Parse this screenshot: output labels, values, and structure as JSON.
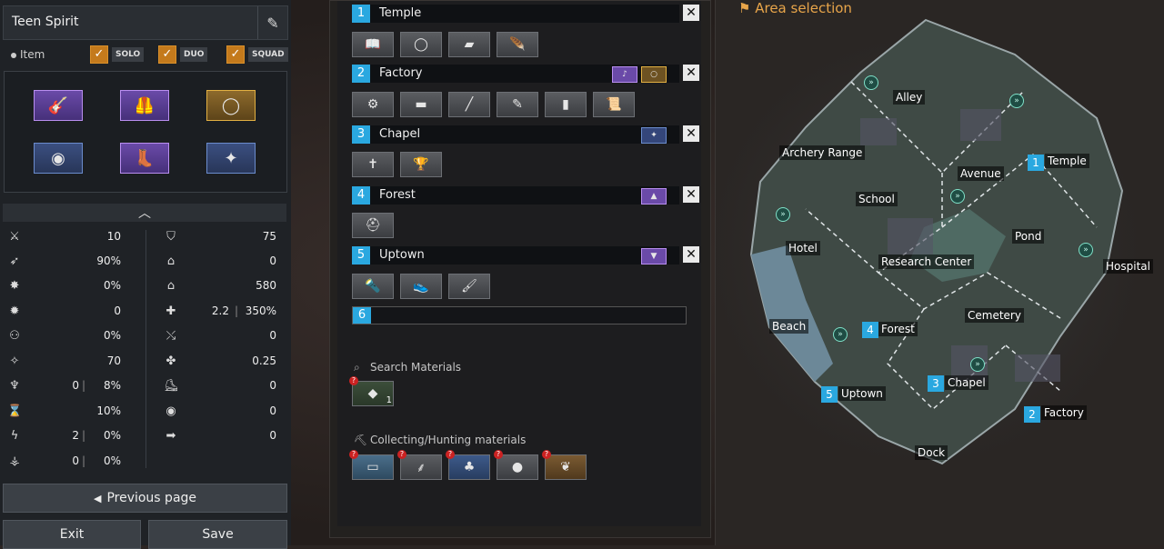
{
  "left": {
    "build_name": "Teen Spirit",
    "item_label": "Item",
    "modes": [
      "SOLO",
      "DUO",
      "SQUAD"
    ],
    "equipment": [
      {
        "icon": "guitar-icon",
        "rarity": "epic"
      },
      {
        "icon": "chest-armor-icon",
        "rarity": "epic"
      },
      {
        "icon": "wreath-icon",
        "rarity": "legendary"
      },
      {
        "icon": "ring-icon",
        "rarity": "rare"
      },
      {
        "icon": "boots-icon",
        "rarity": "epic"
      },
      {
        "icon": "bracelet-icon",
        "rarity": "rare"
      }
    ],
    "stats_left": [
      {
        "icon": "attack-power-icon",
        "value": "10"
      },
      {
        "icon": "attack-speed-icon",
        "value": "90%"
      },
      {
        "icon": "critical-chance-icon",
        "value": "0%"
      },
      {
        "icon": "critical-damage-icon",
        "value": "0"
      },
      {
        "icon": "life-steal-icon",
        "value": "0%"
      },
      {
        "icon": "skill-amp-icon",
        "value": "70"
      },
      {
        "icon": "cooldown-icon",
        "pre": "0",
        "value": "8%"
      },
      {
        "icon": "hourglass-icon",
        "value": "10%"
      },
      {
        "icon": "penetration-icon",
        "pre": "2",
        "value": "0%"
      },
      {
        "icon": "omnisyphon-icon",
        "pre": "0",
        "value": "0%"
      }
    ],
    "stats_right": [
      {
        "icon": "defense-icon",
        "value": "75"
      },
      {
        "icon": "hp-regen-icon",
        "value": "0"
      },
      {
        "icon": "max-hp-icon",
        "value": "580"
      },
      {
        "icon": "heal-icon",
        "pre": "2.2",
        "value": "350%"
      },
      {
        "icon": "tenacity-icon",
        "value": "0"
      },
      {
        "icon": "sp-regen-icon",
        "value": "0.25"
      },
      {
        "icon": "movement-icon",
        "value": "0"
      },
      {
        "icon": "vision-icon",
        "value": "0"
      },
      {
        "icon": "move-speed-icon",
        "value": "0"
      }
    ],
    "prev_page": "Previous page",
    "exit": "Exit",
    "save": "Save"
  },
  "routes": [
    {
      "num": "1",
      "name": "Temple",
      "tags": [],
      "materials": [
        "book-icon",
        "wire-icon",
        "leather-icon",
        "feather-icon"
      ]
    },
    {
      "num": "2",
      "name": "Factory",
      "tags": [
        "guitar-icon",
        "wreath-icon"
      ],
      "materials": [
        "gun-part-icon",
        "tube-icon",
        "rod-icon",
        "syringe-icon",
        "battery-icon",
        "scroll-icon"
      ]
    },
    {
      "num": "3",
      "name": "Chapel",
      "tags": [
        "bracelet-icon"
      ],
      "materials": [
        "cross-icon",
        "chalice-icon"
      ]
    },
    {
      "num": "4",
      "name": "Forest",
      "tags": [
        "chest-armor-icon"
      ],
      "materials": [
        "helmet-icon"
      ]
    },
    {
      "num": "5",
      "name": "Uptown",
      "tags": [
        "boots-icon"
      ],
      "materials": [
        "torch-icon",
        "sneakers-icon",
        "brush-icon"
      ]
    }
  ],
  "route6_num": "6",
  "search_materials": {
    "title": "Search Materials",
    "count": "1"
  },
  "collecting": {
    "title": "Collecting/Hunting materials"
  },
  "map": {
    "title": "Area selection",
    "areas": [
      "Alley",
      "Temple",
      "Archery Range",
      "Avenue",
      "School",
      "Hotel",
      "Pond",
      "Hospital",
      "Research Center",
      "Beach",
      "Forest",
      "Cemetery",
      "Chapel",
      "Uptown",
      "Factory",
      "Dock"
    ],
    "route_markers": [
      "1",
      "2",
      "3",
      "4",
      "5"
    ]
  },
  "colors": {
    "accent": "#2aa8e0",
    "title": "#e8a54a",
    "check": "#c47a1c"
  }
}
